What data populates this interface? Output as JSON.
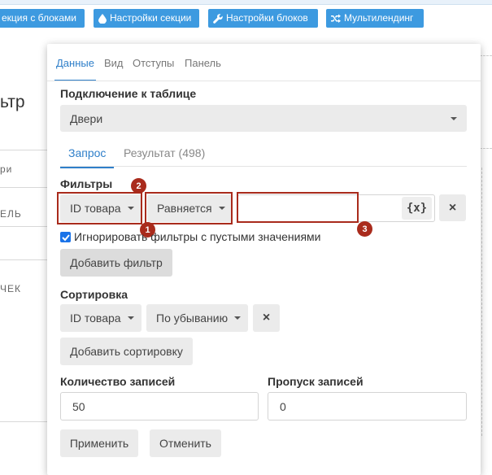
{
  "toolbar": {
    "items": [
      {
        "label": "екция с блоками"
      },
      {
        "label": "Настройки секции",
        "icon": "drop-icon"
      },
      {
        "label": "Настройки блоков",
        "icon": "wrench-icon"
      },
      {
        "label": "Мультилендинг",
        "icon": "shuffle-icon"
      }
    ]
  },
  "background": {
    "heading": "ьтр",
    "rows": [
      "ри",
      "ЕЛЬ",
      "ЧЕК"
    ]
  },
  "panel": {
    "tabs": [
      "Данные",
      "Вид",
      "Отступы",
      "Панель"
    ],
    "active_tab": "Данные",
    "table_label": "Подключение к таблице",
    "table_value": "Двери",
    "subtabs": [
      "Запрос",
      "Результат (498)"
    ],
    "active_subtab": "Запрос",
    "filters_label": "Фильтры",
    "filter": {
      "field": "ID товара",
      "operator": "Равняется",
      "value": "",
      "var_button": "{x}",
      "remove": "×"
    },
    "ignore_empty_label": "Игнорировать фильтры с пустыми значениями",
    "ignore_empty_checked": true,
    "add_filter": "Добавить фильтр",
    "sort_label": "Сортировка",
    "sort": {
      "field": "ID товара",
      "direction": "По убыванию",
      "remove": "×"
    },
    "add_sort": "Добавить сортировку",
    "count_label": "Количество записей",
    "count_value": "50",
    "skip_label": "Пропуск записей",
    "skip_value": "0",
    "apply": "Применить",
    "cancel": "Отменить"
  },
  "annotations": [
    "1",
    "2",
    "3"
  ],
  "colors": {
    "accent": "#3d9ae0",
    "link": "#2f7fc9",
    "highlight": "#a92b1c"
  }
}
